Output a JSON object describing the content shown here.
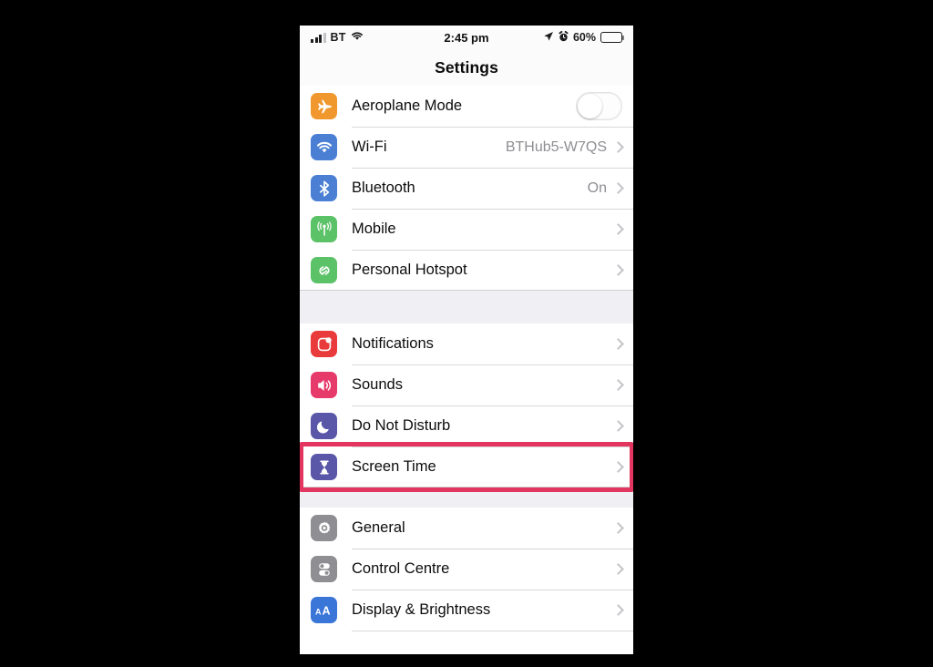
{
  "status_bar": {
    "carrier": "BT",
    "time": "2:45 pm",
    "battery_percent": "60%",
    "battery_level": 60,
    "signal_bars": 3,
    "icons": [
      "signal-bars-icon",
      "wifi-icon",
      "location-arrow-icon",
      "alarm-clock-icon",
      "battery-icon"
    ]
  },
  "nav": {
    "title": "Settings"
  },
  "groups": [
    {
      "id": "connectivity",
      "rows": [
        {
          "label": "Aeroplane Mode",
          "icon": "aeroplane-icon",
          "icon_color": "#f0982d",
          "control": "toggle",
          "toggle_on": false
        },
        {
          "label": "Wi-Fi",
          "icon": "wifi-icon",
          "icon_color": "#4a7fd4",
          "value": "BTHub5-W7QS",
          "control": "chevron"
        },
        {
          "label": "Bluetooth",
          "icon": "bluetooth-icon",
          "icon_color": "#4a7fd4",
          "value": "On",
          "control": "chevron"
        },
        {
          "label": "Mobile",
          "icon": "mobile-antenna-icon",
          "icon_color": "#5cc268",
          "control": "chevron"
        },
        {
          "label": "Personal Hotspot",
          "icon": "personal-hotspot-icon",
          "icon_color": "#5cc268",
          "control": "chevron"
        }
      ]
    },
    {
      "id": "alerts",
      "rows": [
        {
          "label": "Notifications",
          "icon": "notifications-icon",
          "icon_color": "#e93b3b",
          "control": "chevron"
        },
        {
          "label": "Sounds",
          "icon": "sounds-icon",
          "icon_color": "#e63a6b",
          "control": "chevron"
        },
        {
          "label": "Do Not Disturb",
          "icon": "moon-icon",
          "icon_color": "#5a57a8",
          "control": "chevron"
        },
        {
          "label": "Screen Time",
          "icon": "hourglass-icon",
          "icon_color": "#5a57a8",
          "control": "chevron",
          "highlighted": true
        }
      ]
    },
    {
      "id": "system",
      "rows": [
        {
          "label": "General",
          "icon": "gear-icon",
          "icon_color": "#8e8e93",
          "control": "chevron"
        },
        {
          "label": "Control Centre",
          "icon": "control-centre-icon",
          "icon_color": "#8e8e93",
          "control": "chevron"
        },
        {
          "label": "Display & Brightness",
          "icon": "display-brightness-icon",
          "icon_color": "#3a76d8",
          "control": "chevron"
        }
      ]
    }
  ],
  "highlight": {
    "color": "#e2355f",
    "target_label": "Screen Time"
  }
}
